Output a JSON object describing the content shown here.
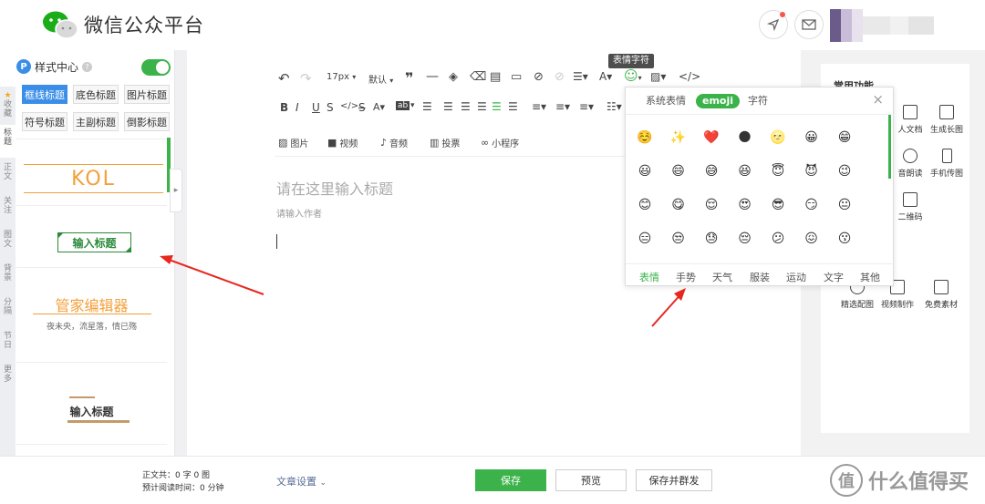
{
  "header": {
    "brand": "微信公众平台"
  },
  "left_panel": {
    "vertical_tabs": [
      "收藏",
      "标题",
      "正文",
      "关注",
      "图文",
      "背景",
      "分隔",
      "节日",
      "更多"
    ],
    "style_center": {
      "icon": "P",
      "label": "样式中心",
      "help": "?",
      "toggle_on": true
    },
    "categories": [
      "框线标题",
      "底色标题",
      "图片标题",
      "符号标题",
      "主副标题",
      "倒影标题"
    ],
    "active_category": "框线标题",
    "templates": [
      {
        "text": "KOL"
      },
      {
        "text": "输入标题"
      },
      {
        "text": "管家编辑器",
        "sub": "夜未央，流星落，情已殇"
      },
      {
        "text": "输入标题"
      }
    ]
  },
  "toolbar": {
    "font_size": "17px",
    "font_family": "默认",
    "tooltip": "表情字符",
    "media": [
      "图片",
      "视频",
      "音频",
      "投票",
      "小程序"
    ]
  },
  "editor": {
    "title_placeholder": "请在这里输入标题",
    "author_placeholder": "请输入作者"
  },
  "emoji_panel": {
    "tabs": [
      "系统表情",
      "emoji",
      "字符"
    ],
    "active_tab": "emoji",
    "close": "×",
    "categories": [
      "表情",
      "手势",
      "天气",
      "服装",
      "运动",
      "文字",
      "其他"
    ],
    "active_category": "表情",
    "emojis": [
      "☺️",
      "✨",
      "❤️",
      "🌑",
      "🌝",
      "😀",
      "😁",
      "😃",
      "😄",
      "😅",
      "😆",
      "😇",
      "😈",
      "😉",
      "😊",
      "😋",
      "😌",
      "😍",
      "😎",
      "😏",
      "😐",
      "😑",
      "😒",
      "😓",
      "😔",
      "😕",
      "😖",
      "😗"
    ]
  },
  "right_panel": {
    "title": "常用功能",
    "items": [
      "人文档",
      "生成长图",
      "音朗读",
      "手机传图",
      "二维码",
      "精选配图",
      "视频制作",
      "免费素材"
    ]
  },
  "bottom_bar": {
    "word_count": "正文共：0 字 0 图",
    "read_time": "预计阅读时间：0 分钟",
    "article_settings": "文章设置",
    "save": "保存",
    "preview": "预览",
    "save_publish": "保存并群发",
    "watermark": "什么值得买",
    "watermark_icon": "值"
  },
  "colors": {
    "accent_green": "#3bb34a",
    "accent_blue": "#3b8ee8",
    "arrow_red": "#e8271f",
    "kol_orange": "#f2a03a"
  }
}
